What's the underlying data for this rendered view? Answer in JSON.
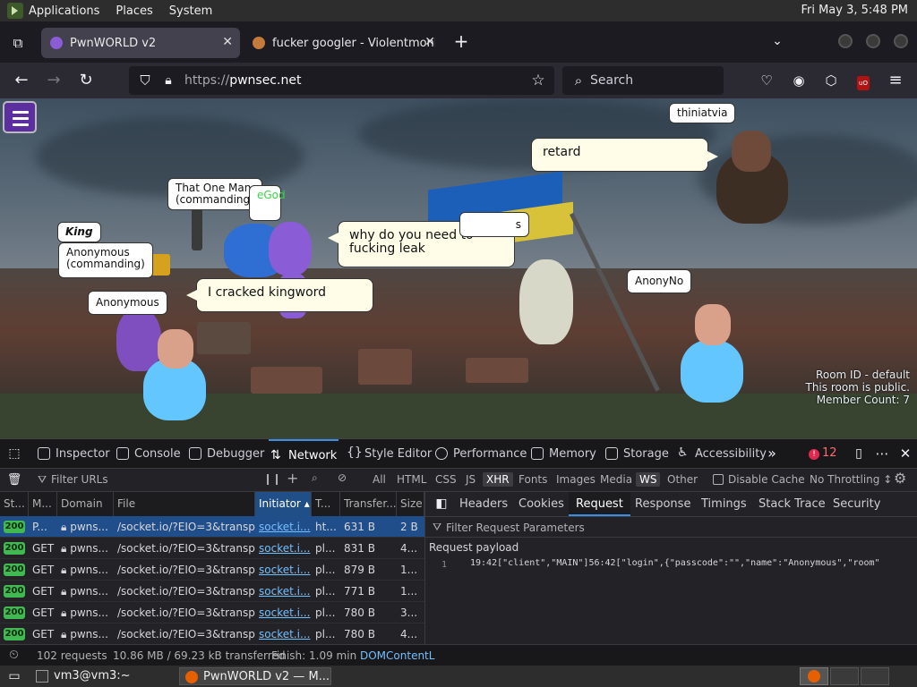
{
  "gnome": {
    "menus": [
      "Applications",
      "Places",
      "System"
    ],
    "clock": "Fri May 3,  5:48 PM"
  },
  "tabs": [
    {
      "label": "PwnWORLD v2",
      "active": true
    },
    {
      "label": "fucker googler - Violentmonkey",
      "active": false
    }
  ],
  "nav": {
    "url_scheme": "https://",
    "url_host": "pwnsec.net",
    "search_placeholder": "Search"
  },
  "scene": {
    "bubbles": {
      "thiniatvia": "thiniatvia",
      "retard": "retard",
      "that_one_man": "That One Man\n(commanding)",
      "god_fragment": "eGod",
      "king": "King",
      "anon_commanding": "Anonymous\n(commanding)",
      "why_leak": "why do you need to fucking leak",
      "partial_s": "s",
      "anonyno": "AnonyNo",
      "anonymous": "Anonymous",
      "cracked": "I cracked kingword"
    },
    "room_info": {
      "line1": "Room ID - default",
      "line2": "This room is public.",
      "line3": "Member Count: 7"
    }
  },
  "devtools": {
    "tabs": [
      "Inspector",
      "Console",
      "Debugger",
      "Network",
      "Style Editor",
      "Performance",
      "Memory",
      "Storage",
      "Accessibility"
    ],
    "active_tab": "Network",
    "error_count": "12",
    "filter_placeholder": "Filter URLs",
    "type_filters": [
      "All",
      "HTML",
      "CSS",
      "JS",
      "XHR",
      "Fonts",
      "Images",
      "Media",
      "WS",
      "Other"
    ],
    "disable_cache": "Disable Cache",
    "throttling": "No Throttling ↕",
    "columns": [
      "St...",
      "M...",
      "Domain",
      "File",
      "Initiator",
      "T...",
      "Transfer...",
      "Size"
    ],
    "rows": [
      {
        "status": "200",
        "method": "P...",
        "domain": "pwns...",
        "file": "/socket.io/?EIO=3&transport=p",
        "initiator": "socket.i...",
        "type": "ht...",
        "transfer": "631 B",
        "size": "2 B"
      },
      {
        "status": "200",
        "method": "GET",
        "domain": "pwns...",
        "file": "/socket.io/?EIO=3&transport=p",
        "initiator": "socket.i...",
        "type": "pl...",
        "transfer": "831 B",
        "size": "4..."
      },
      {
        "status": "200",
        "method": "GET",
        "domain": "pwns...",
        "file": "/socket.io/?EIO=3&transport=p",
        "initiator": "socket.i...",
        "type": "pl...",
        "transfer": "879 B",
        "size": "1..."
      },
      {
        "status": "200",
        "method": "GET",
        "domain": "pwns...",
        "file": "/socket.io/?EIO=3&transport=p",
        "initiator": "socket.i...",
        "type": "pl...",
        "transfer": "771 B",
        "size": "1..."
      },
      {
        "status": "200",
        "method": "GET",
        "domain": "pwns...",
        "file": "/socket.io/?EIO=3&transport=p",
        "initiator": "socket.i...",
        "type": "pl...",
        "transfer": "780 B",
        "size": "3..."
      },
      {
        "status": "200",
        "method": "GET",
        "domain": "pwns...",
        "file": "/socket.io/?EIO=3&transport=p",
        "initiator": "socket.i...",
        "type": "pl...",
        "transfer": "780 B",
        "size": "4..."
      }
    ],
    "detail_tabs": [
      "Headers",
      "Cookies",
      "Request",
      "Response",
      "Timings",
      "Stack Trace",
      "Security"
    ],
    "detail_active": "Request",
    "filter_params": "Filter Request Parameters",
    "payload_title": "Request payload",
    "payload_line_no": "1",
    "payload": "19:42[\"client\",\"MAIN\"]56:42[\"login\",{\"passcode\":\"\",\"name\":\"Anonymous\",\"room\"",
    "status_requests": "102 requests",
    "status_transferred": "10.86 MB / 69.23 kB transferred",
    "status_finish": "Finish: 1.09 min",
    "status_dom": "DOMContentL"
  },
  "taskbar": [
    {
      "label": "vm3@vm3:~"
    },
    {
      "label": "PwnWORLD v2 — M..."
    }
  ]
}
